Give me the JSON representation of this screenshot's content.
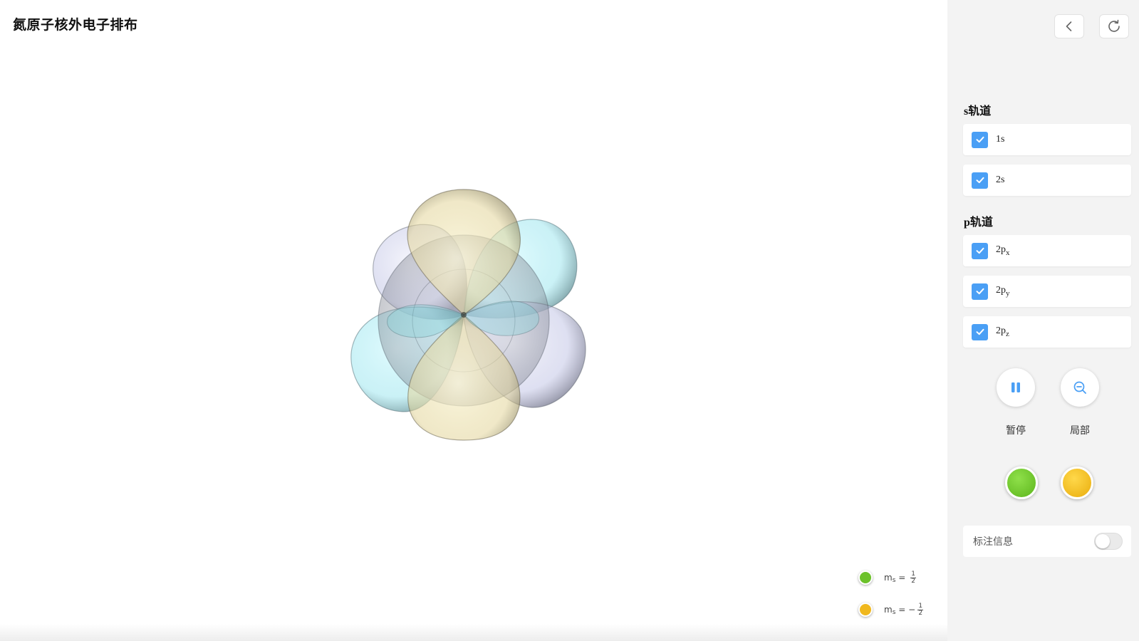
{
  "page": {
    "title": "氮原子核外电子排布"
  },
  "legend": [
    {
      "label": "m",
      "subscript": "s",
      "equals": "=",
      "sign": "",
      "numerator": "1",
      "denominator": "2",
      "color": "#6cc12a"
    },
    {
      "label": "m",
      "subscript": "s",
      "equals": "=",
      "sign": "−",
      "numerator": "1",
      "denominator": "2",
      "color": "#f0b81e"
    }
  ],
  "toolbar": {
    "back_icon": "chevron-left-icon",
    "refresh_icon": "refresh-icon"
  },
  "s_section": {
    "label": "s轨道",
    "items": [
      {
        "label": "1s",
        "checked": true
      },
      {
        "label": "2s",
        "checked": true
      }
    ]
  },
  "p_section": {
    "label": "p轨道",
    "items": [
      {
        "base": "2p",
        "sub": "x",
        "checked": true
      },
      {
        "base": "2p",
        "sub": "y",
        "checked": true
      },
      {
        "base": "2p",
        "sub": "z",
        "checked": true
      }
    ]
  },
  "controls": {
    "pause_label": "暂停",
    "zoom_label": "局部",
    "pause_icon": "pause-icon",
    "zoom_icon": "zoom-out-icon"
  },
  "spin_colors": {
    "up": "#6cc12a",
    "down": "#f0b81e"
  },
  "annotation_toggle": {
    "label": "标注信息",
    "on": false
  },
  "orbital_colors": {
    "cyan": "#9fe6ef",
    "lavender": "#c3c6e6",
    "gold": "#e8dba0"
  }
}
